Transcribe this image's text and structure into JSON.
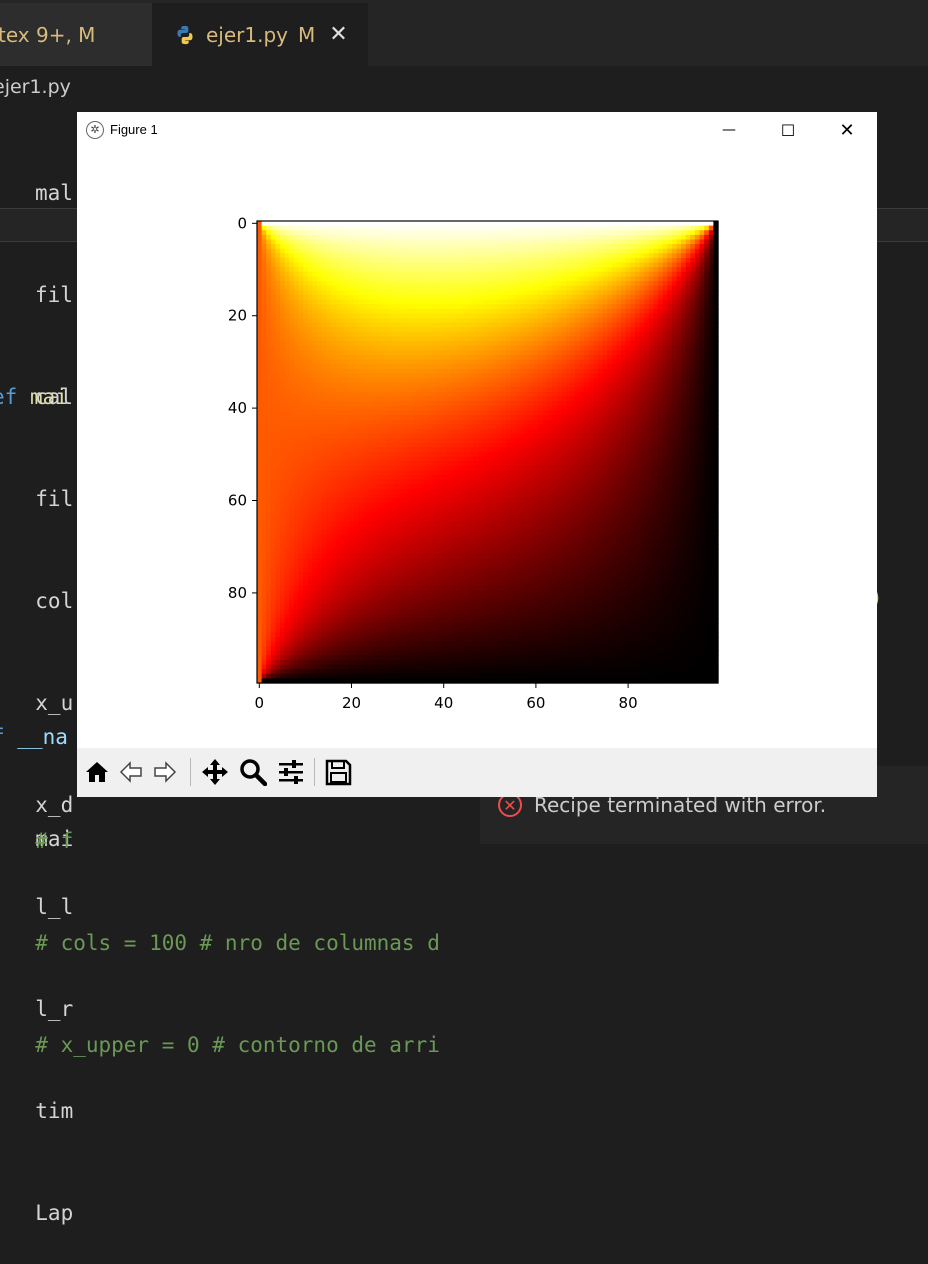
{
  "editor": {
    "tabs": [
      {
        "label": "tex 9+, M"
      },
      {
        "label": "ejer1.py",
        "status": "M"
      }
    ],
    "breadcrumb": "ejer1.py",
    "peek_lines": [
      "mal",
      "fil",
      "cal"
    ],
    "main_lines": [
      {
        "kw": "ef",
        "rest": " mai"
      },
      {
        "rest": "  fil"
      },
      {
        "rest": "  col"
      },
      {
        "rest": "  x_u"
      },
      {
        "rest": "  x_d"
      },
      {
        "rest": "  l_l"
      },
      {
        "rest": "  l_r"
      },
      {
        "rest": "  tim"
      },
      {
        "rest": "  Lap"
      }
    ],
    "if_line": {
      "kw": "f",
      "rest": " __na"
    },
    "main_call": "  mai",
    "comment_lines": [
      "  # f",
      "  # cols = 100 # nro de columnas d",
      "  # x_upper = 0 # contorno de arri"
    ],
    "closing_paren": ")"
  },
  "status": {
    "error_text": "Recipe terminated with error."
  },
  "figure": {
    "title": "Figure 1",
    "window_controls": {
      "minimize": "—",
      "maximize": "☐",
      "close": "✕"
    },
    "toolbar": [
      "home-icon",
      "back-icon",
      "forward-icon",
      "pan-icon",
      "zoom-icon",
      "configure-subplots-icon",
      "save-icon"
    ]
  },
  "chart_data": {
    "type": "heatmap",
    "title": "",
    "xlabel": "",
    "ylabel": "",
    "colormap": "hot",
    "grid_size": [
      100,
      100
    ],
    "xlim": [
      -0.5,
      99.5
    ],
    "ylim": [
      99.5,
      -0.5
    ],
    "xticks": [
      0,
      20,
      40,
      60,
      80
    ],
    "yticks": [
      0,
      20,
      40,
      60,
      80
    ],
    "xtick_labels": [
      "0",
      "20",
      "40",
      "60",
      "80"
    ],
    "ytick_labels": [
      "0",
      "20",
      "40",
      "60",
      "80"
    ],
    "boundary_values": {
      "top": 1.0,
      "left": 0.5,
      "right": 0.0,
      "bottom": 0.0
    },
    "grid": false,
    "colorbar": false
  }
}
